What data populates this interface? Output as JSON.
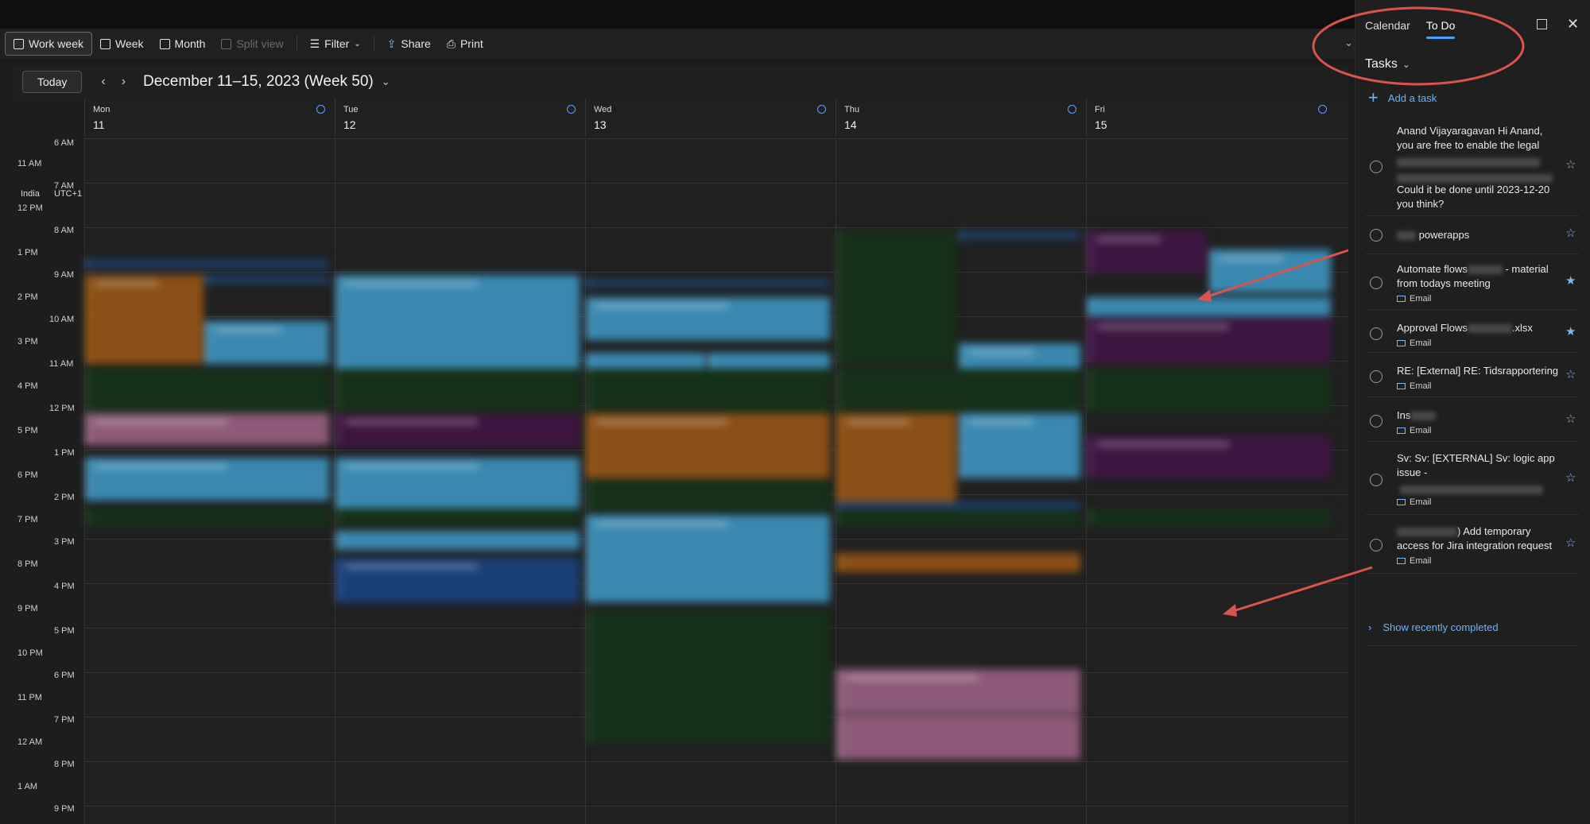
{
  "toolbar": {
    "work_week": "Work week",
    "week": "Week",
    "month": "Month",
    "split_view": "Split view",
    "filter": "Filter",
    "share": "Share",
    "print": "Print"
  },
  "nav": {
    "today": "Today",
    "range_title": "December 11–15, 2023 (Week 50)"
  },
  "timezones": {
    "primary": "India",
    "secondary": "UTC+1"
  },
  "days": [
    {
      "name": "Mon",
      "num": "11"
    },
    {
      "name": "Tue",
      "num": "12"
    },
    {
      "name": "Wed",
      "num": "13"
    },
    {
      "name": "Thu",
      "num": "14"
    },
    {
      "name": "Fri",
      "num": "15"
    }
  ],
  "times_india": [
    "11 AM",
    "12 PM",
    "1 PM",
    "2 PM",
    "3 PM",
    "4 PM",
    "5 PM",
    "6 PM",
    "7 PM",
    "8 PM",
    "9 PM",
    "10 PM",
    "11 PM",
    "12 AM",
    "1 AM"
  ],
  "times_utc": [
    "6 AM",
    "7 AM",
    "8 AM",
    "9 AM",
    "10 AM",
    "11 AM",
    "12 PM",
    "1 PM",
    "2 PM",
    "3 PM",
    "4 PM",
    "5 PM",
    "6 PM",
    "7 PM",
    "8 PM",
    "9 PM"
  ],
  "panel": {
    "tab_calendar": "Calendar",
    "tab_todo": "To Do",
    "tasks_title": "Tasks",
    "add_task": "Add a task",
    "show_completed": "Show recently completed",
    "tasks": [
      {
        "line1": "Anand Vijayaragavan  Hi Anand, you are free to enable the legal",
        "line2": "Could it be done until 2023-12-20 you think?",
        "meta": "",
        "starred": false
      },
      {
        "prefix": "",
        "text": "powerapps",
        "meta": "",
        "starred": false
      },
      {
        "text": "Automate flows",
        "text2": " - material from todays meeting",
        "meta": "Email",
        "starred": true
      },
      {
        "text": "Approval Flows",
        "text2": ".xlsx",
        "meta": "Email",
        "starred": true
      },
      {
        "text": "RE: [External] RE: Tidsrapportering",
        "meta": "Email",
        "starred": false
      },
      {
        "text": "Ins",
        "meta": "Email",
        "starred": false
      },
      {
        "text": "Sv: Sv: [EXTERNAL] Sv: logic app issue -",
        "meta": "Email",
        "starred": false
      },
      {
        "text": ") Add temporary access for Jira integration request",
        "meta": "Email",
        "starred": false
      }
    ]
  },
  "colors": {
    "accent": "#4d9fff",
    "annotation_red": "#d9534f",
    "event_blue": "#3a88b0",
    "event_orange": "#8a4f16",
    "event_green": "#153019",
    "event_purple": "#3d1540",
    "event_pink": "#8d5a79"
  },
  "icons": {
    "work_week": "calendar-workweek-icon",
    "week": "calendar-week-icon",
    "month": "calendar-month-icon",
    "split_view": "split-view-icon",
    "filter": "filter-icon",
    "share": "share-icon",
    "print": "printer-icon",
    "star": "star-icon",
    "email": "envelope-icon"
  }
}
